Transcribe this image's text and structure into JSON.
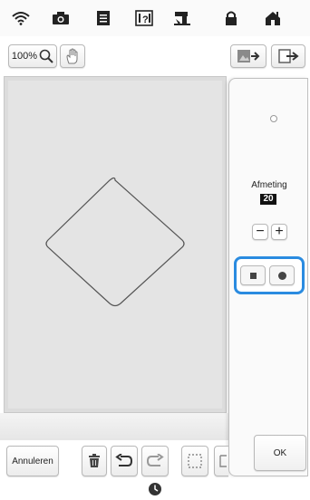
{
  "toolbar": {
    "zoom_value": "100%"
  },
  "panel": {
    "size_label": "Afmeting",
    "size_value": "20",
    "minus_label": "−",
    "plus_label": "+",
    "ok_label": "OK",
    "selected_shape": "circle"
  },
  "bottom": {
    "cancel_label": "Annuleren"
  },
  "colors": {
    "selection_highlight": "#2a8be0",
    "canvas_bg": "#e4e4e4",
    "shape_stroke": "#555555"
  },
  "icons": {
    "top": [
      "wifi-icon",
      "camera-icon",
      "document-icon",
      "help-icon",
      "machine-icon",
      "home-icon",
      "lock-icon"
    ]
  }
}
